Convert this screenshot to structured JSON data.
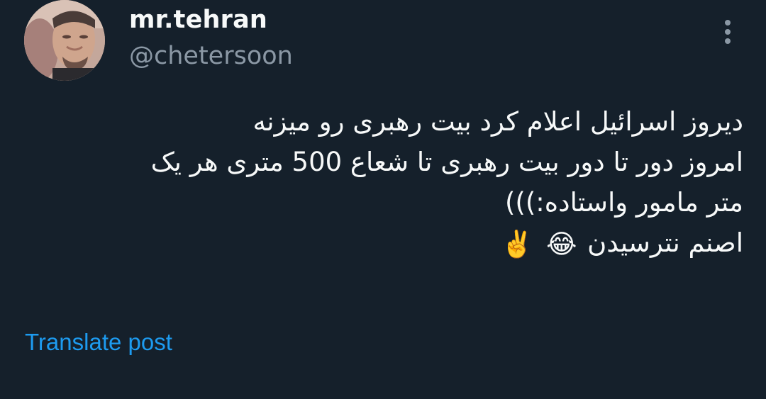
{
  "author": {
    "display_name": "mr.tehran",
    "handle": "@chetersoon"
  },
  "post": {
    "lines": [
      "دیروز اسرائیل اعلام کرد بیت رهبری رو میزنه",
      "امروز دور تا دور بیت رهبری تا شعاع 500 متری هر یک",
      "متر مامور واستاده:)))",
      "اصنم نترسیدن"
    ],
    "emojis": [
      "😂",
      "✌️"
    ]
  },
  "actions": {
    "translate_label": "Translate post"
  },
  "colors": {
    "background": "#15202b",
    "primary_text": "#f7f9f9",
    "secondary_text": "#8b98a5",
    "link": "#1d9bf0"
  },
  "icons": {
    "more": "more-vertical-icon"
  }
}
